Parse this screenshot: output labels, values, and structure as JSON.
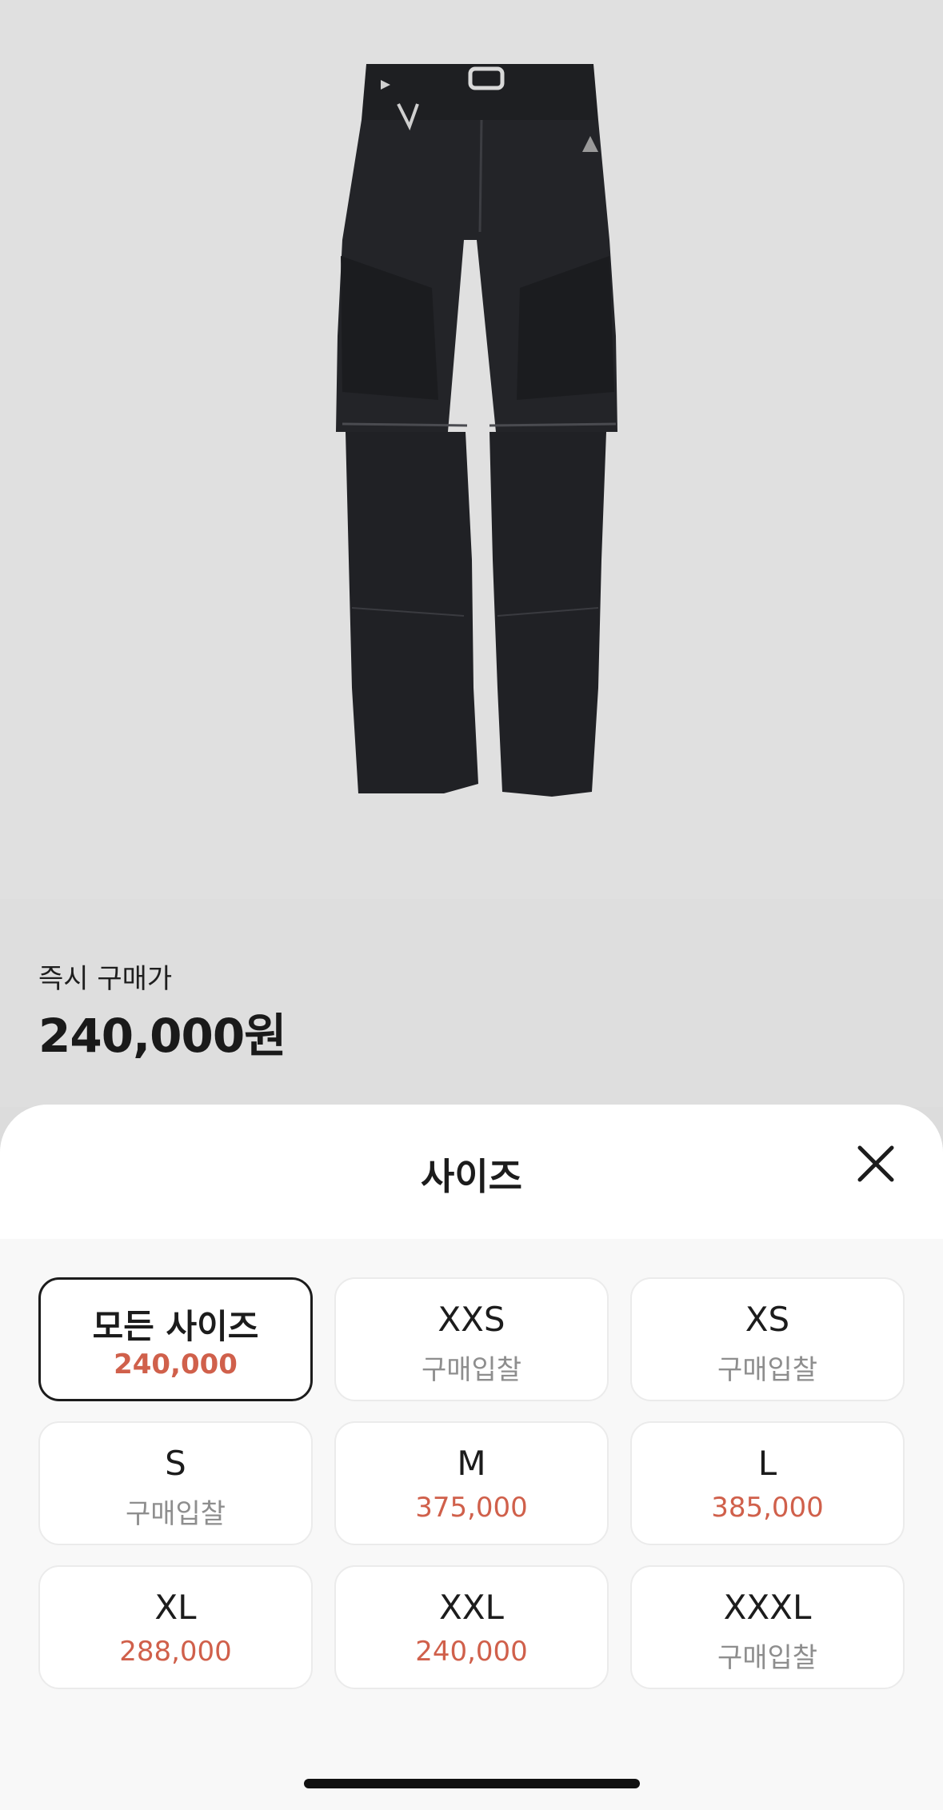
{
  "product": {
    "image_icon": "cargo-pants-image"
  },
  "price_section": {
    "label": "즉시 구매가",
    "value": "240,000원"
  },
  "size_sheet": {
    "title": "사이즈",
    "close_icon": "close-icon",
    "options": [
      {
        "name": "모든 사이즈",
        "sub": "240,000",
        "type": "price",
        "selected": true
      },
      {
        "name": "XXS",
        "sub": "구매입찰",
        "type": "bid",
        "selected": false
      },
      {
        "name": "XS",
        "sub": "구매입찰",
        "type": "bid",
        "selected": false
      },
      {
        "name": "S",
        "sub": "구매입찰",
        "type": "bid",
        "selected": false
      },
      {
        "name": "M",
        "sub": "375,000",
        "type": "price",
        "selected": false
      },
      {
        "name": "L",
        "sub": "385,000",
        "type": "price",
        "selected": false
      },
      {
        "name": "XL",
        "sub": "288,000",
        "type": "price",
        "selected": false
      },
      {
        "name": "XXL",
        "sub": "240,000",
        "type": "price",
        "selected": false
      },
      {
        "name": "XXXL",
        "sub": "구매입찰",
        "type": "bid",
        "selected": false
      }
    ]
  },
  "colors": {
    "price_red": "#d0604b",
    "bid_gray": "#8e8e8e",
    "selected_border": "#1c1c1c"
  }
}
